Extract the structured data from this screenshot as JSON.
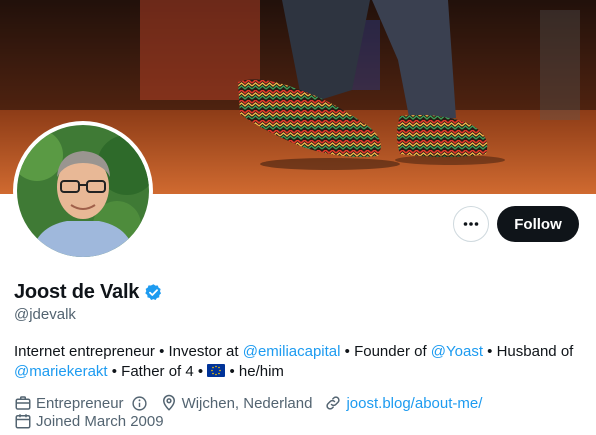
{
  "profile": {
    "display_name": "Joost de Valk",
    "handle": "@jdevalk",
    "verified_icon": "verified-badge-icon"
  },
  "actions": {
    "more_icon": "more-options-icon",
    "follow_label": "Follow"
  },
  "bio": {
    "part1": "Internet entrepreneur • Investor at ",
    "mention1": "@emiliacapital",
    "part2": " • Founder of ",
    "mention2": "@Yoast",
    "part3": " • Husband of ",
    "mention3": "@mariekerakt",
    "part4": " • Father of 4 • ",
    "part5": " • he/him"
  },
  "meta": {
    "profession": "Entrepreneur",
    "location": "Wijchen, Nederland",
    "website": "joost.blog/about-me/",
    "joined": "Joined March 2009"
  },
  "colors": {
    "accent": "#1d9bf0",
    "text_primary": "#0f1419",
    "text_secondary": "#536471",
    "follow_bg": "#0f1419"
  }
}
